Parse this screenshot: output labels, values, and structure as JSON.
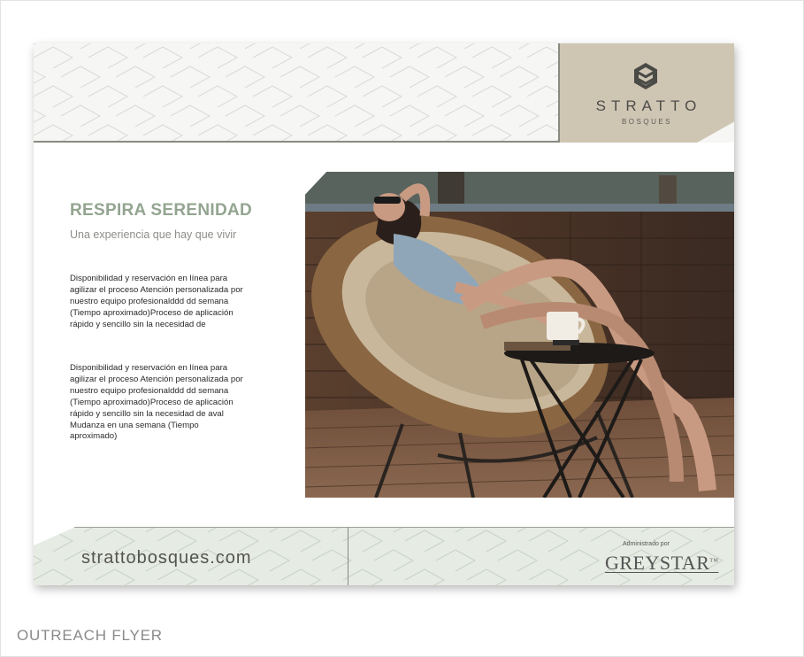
{
  "flyer": {
    "brand": {
      "name": "STRATTO",
      "sub": "BOSQUES",
      "logo_icon": "cube-logo-icon"
    },
    "headline": "RESPIRA SERENIDAD",
    "subheadline": "Una experiencia que hay que vivir",
    "paragraphs": [
      "Disponibilidad y reservación en línea para agilizar el proceso Atención personalizada por nuestro equipo profesionalddd dd semana (Tiempo aproximado)Proceso de aplicación rápido y sencillo sin la necesidad de",
      "Disponibilidad y reservación en línea para agilizar el proceso Atención personalizada por nuestro equipo profesionalddd dd semana (Tiempo aproximado)Proceso de aplicación rápido y sencillo sin la necesidad de aval Mudanza en una semana (Tiempo aproximado)"
    ],
    "footer": {
      "website": "strattobosques.com",
      "admin_label": "Administrado por",
      "company": "GREYSTAR",
      "trademark": "TM"
    },
    "colors": {
      "accent_green": "#93a590",
      "brand_panel": "#cfc5b3",
      "footer_band": "#e6ebe3"
    }
  },
  "caption": "OUTREACH FLYER"
}
